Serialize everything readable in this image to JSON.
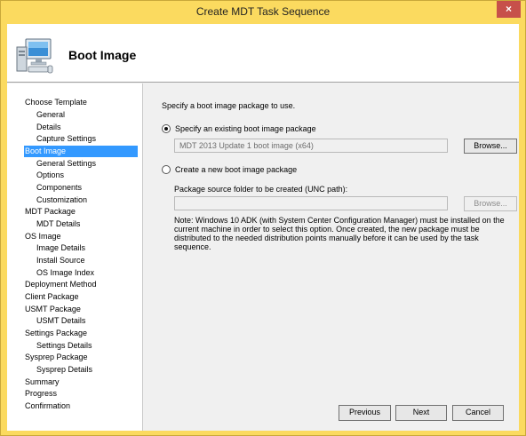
{
  "window": {
    "title": "Create MDT Task Sequence",
    "close_glyph": "×"
  },
  "header": {
    "title": "Boot Image",
    "icon": "computer-icon"
  },
  "nav": {
    "items": [
      {
        "label": "Choose Template"
      },
      {
        "label": "General"
      },
      {
        "label": "Details"
      },
      {
        "label": "Capture Settings"
      },
      {
        "label": "Boot Image"
      },
      {
        "label": "General Settings"
      },
      {
        "label": "Options"
      },
      {
        "label": "Components"
      },
      {
        "label": "Customization"
      },
      {
        "label": "MDT Package"
      },
      {
        "label": "MDT Details"
      },
      {
        "label": "OS Image"
      },
      {
        "label": "Image Details"
      },
      {
        "label": "Install Source"
      },
      {
        "label": "OS Image Index"
      },
      {
        "label": "Deployment Method"
      },
      {
        "label": "Client Package"
      },
      {
        "label": "USMT Package"
      },
      {
        "label": "USMT Details"
      },
      {
        "label": "Settings Package"
      },
      {
        "label": "Settings Details"
      },
      {
        "label": "Sysprep Package"
      },
      {
        "label": "Sysprep Details"
      },
      {
        "label": "Summary"
      },
      {
        "label": "Progress"
      },
      {
        "label": "Confirmation"
      }
    ],
    "selected": "Boot Image"
  },
  "main": {
    "intro": "Specify a boot image package to use.",
    "option_existing": "Specify an existing boot image package",
    "existing_value": "MDT 2013 Update 1 boot image (x64)",
    "browse_label": "Browse...",
    "option_new": "Create a new boot image package",
    "source_folder_label": "Package source folder to be created (UNC path):",
    "source_folder_value": "",
    "browse_label_2": "Browse...",
    "note": "Note: Windows 10 ADK (with System Center Configuration Manager) must be installed on the current machine in order to select this option.  Once created, the new package must be distributed to the needed distribution points manually before it can be used by the task sequence."
  },
  "footer": {
    "previous_label": "Previous",
    "next_label": "Next",
    "cancel_label": "Cancel"
  },
  "colors": {
    "title_bar": "#fbda5f",
    "selection": "#3399ff",
    "close_button": "#c7504a"
  }
}
